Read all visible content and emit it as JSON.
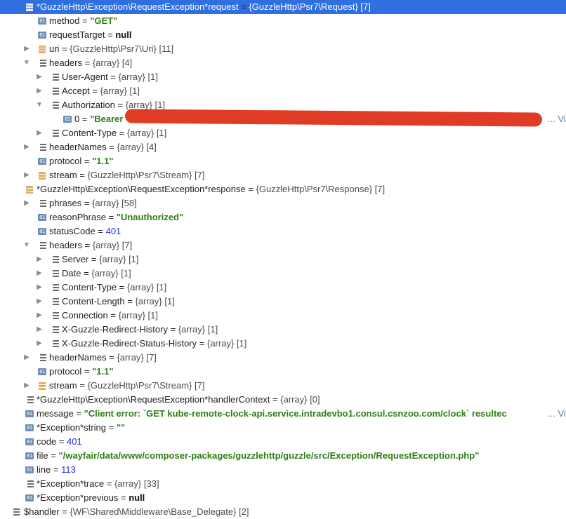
{
  "rows": [
    {
      "id": "request",
      "depth": 0,
      "arrow": "open",
      "icon": "obj",
      "name": "*GuzzleHttp\\Exception\\RequestException*request",
      "type": "{GuzzleHttp\\Psr7\\Request}",
      "count": "[7]",
      "selected": true
    },
    {
      "id": "method",
      "depth": 1,
      "icon": "prim",
      "name": "method",
      "value": "\"GET\"",
      "vkind": "str"
    },
    {
      "id": "requestTarget",
      "depth": 1,
      "icon": "prim",
      "name": "requestTarget",
      "value": "null",
      "vkind": "kw"
    },
    {
      "id": "uri",
      "depth": 1,
      "arrow": "closed",
      "icon": "obj",
      "name": "uri",
      "type": "{GuzzleHttp\\Psr7\\Uri}",
      "count": "[11]"
    },
    {
      "id": "headers1",
      "depth": 1,
      "arrow": "open",
      "icon": "list",
      "name": "headers",
      "type": "{array}",
      "count": "[4]"
    },
    {
      "id": "user-agent",
      "depth": 2,
      "arrow": "closed",
      "icon": "list",
      "name": "User-Agent",
      "type": "{array}",
      "count": "[1]"
    },
    {
      "id": "accept",
      "depth": 2,
      "arrow": "closed",
      "icon": "list",
      "name": "Accept",
      "type": "{array}",
      "count": "[1]"
    },
    {
      "id": "authorization",
      "depth": 2,
      "arrow": "open",
      "icon": "list",
      "name": "Authorization",
      "type": "{array}",
      "count": "[1]"
    },
    {
      "id": "auth-0",
      "depth": 3,
      "icon": "prim",
      "name": "0",
      "value": "\"Bearer",
      "vkind": "str",
      "tail": "... View"
    },
    {
      "id": "content-type1",
      "depth": 2,
      "arrow": "closed",
      "icon": "list",
      "name": "Content-Type",
      "type": "{array}",
      "count": "[1]"
    },
    {
      "id": "headerNames1",
      "depth": 1,
      "arrow": "closed",
      "icon": "list",
      "name": "headerNames",
      "type": "{array}",
      "count": "[4]"
    },
    {
      "id": "protocol1",
      "depth": 1,
      "icon": "prim",
      "name": "protocol",
      "value": "\"1.1\"",
      "vkind": "str"
    },
    {
      "id": "stream1",
      "depth": 1,
      "arrow": "closed",
      "icon": "obj",
      "name": "stream",
      "type": "{GuzzleHttp\\Psr7\\Stream}",
      "count": "[7]"
    },
    {
      "id": "response",
      "depth": 0,
      "arrow": "open",
      "icon": "obj",
      "name": "*GuzzleHttp\\Exception\\RequestException*response",
      "type": "{GuzzleHttp\\Psr7\\Response}",
      "count": "[7]"
    },
    {
      "id": "phrases",
      "depth": 1,
      "arrow": "closed",
      "icon": "list",
      "name": "phrases",
      "type": "{array}",
      "count": "[58]"
    },
    {
      "id": "reasonPhrase",
      "depth": 1,
      "icon": "prim",
      "name": "reasonPhrase",
      "value": "\"Unauthorized\"",
      "vkind": "str"
    },
    {
      "id": "statusCode",
      "depth": 1,
      "icon": "prim",
      "name": "statusCode",
      "value": "401",
      "vkind": "num"
    },
    {
      "id": "headers2",
      "depth": 1,
      "arrow": "open",
      "icon": "list",
      "name": "headers",
      "type": "{array}",
      "count": "[7]"
    },
    {
      "id": "server",
      "depth": 2,
      "arrow": "closed",
      "icon": "list",
      "name": "Server",
      "type": "{array}",
      "count": "[1]"
    },
    {
      "id": "date",
      "depth": 2,
      "arrow": "closed",
      "icon": "list",
      "name": "Date",
      "type": "{array}",
      "count": "[1]"
    },
    {
      "id": "content-type2",
      "depth": 2,
      "arrow": "closed",
      "icon": "list",
      "name": "Content-Type",
      "type": "{array}",
      "count": "[1]"
    },
    {
      "id": "content-length",
      "depth": 2,
      "arrow": "closed",
      "icon": "list",
      "name": "Content-Length",
      "type": "{array}",
      "count": "[1]"
    },
    {
      "id": "connection",
      "depth": 2,
      "arrow": "closed",
      "icon": "list",
      "name": "Connection",
      "type": "{array}",
      "count": "[1]"
    },
    {
      "id": "x-guzzle-redirect-history",
      "depth": 2,
      "arrow": "closed",
      "icon": "list",
      "name": "X-Guzzle-Redirect-History",
      "type": "{array}",
      "count": "[1]"
    },
    {
      "id": "x-guzzle-redirect-status-history",
      "depth": 2,
      "arrow": "closed",
      "icon": "list",
      "name": "X-Guzzle-Redirect-Status-History",
      "type": "{array}",
      "count": "[1]"
    },
    {
      "id": "headerNames2",
      "depth": 1,
      "arrow": "closed",
      "icon": "list",
      "name": "headerNames",
      "type": "{array}",
      "count": "[7]"
    },
    {
      "id": "protocol2",
      "depth": 1,
      "icon": "prim",
      "name": "protocol",
      "value": "\"1.1\"",
      "vkind": "str"
    },
    {
      "id": "stream2",
      "depth": 1,
      "arrow": "closed",
      "icon": "obj",
      "name": "stream",
      "type": "{GuzzleHttp\\Psr7\\Stream}",
      "count": "[7]"
    },
    {
      "id": "handlerContext",
      "depth": 0,
      "icon": "list",
      "name": "*GuzzleHttp\\Exception\\RequestException*handlerContext",
      "type": "{array}",
      "count": "[0]"
    },
    {
      "id": "message",
      "depth": 0,
      "icon": "prim",
      "name": "message",
      "value": "\"Client error: `GET kube-remote-clock-api.service.intradevbo1.consul.csnzoo.com/clock` resultec",
      "vkind": "str",
      "tail": "... View"
    },
    {
      "id": "exception-string",
      "depth": 0,
      "icon": "prim",
      "name": "*Exception*string",
      "value": "\"\"",
      "vkind": "str"
    },
    {
      "id": "code",
      "depth": 0,
      "icon": "prim",
      "name": "code",
      "value": "401",
      "vkind": "num"
    },
    {
      "id": "file",
      "depth": 0,
      "icon": "prim",
      "name": "file",
      "value": "\"/wayfair/data/www/composer-packages/guzzlehttp/guzzle/src/Exception/RequestException.php\"",
      "vkind": "str"
    },
    {
      "id": "line",
      "depth": 0,
      "icon": "prim",
      "name": "line",
      "value": "113",
      "vkind": "num"
    },
    {
      "id": "exception-trace",
      "depth": 0,
      "arrow": "closed",
      "icon": "list",
      "name": "*Exception*trace",
      "type": "{array}",
      "count": "[33]"
    },
    {
      "id": "exception-previous",
      "depth": 0,
      "icon": "prim",
      "name": "*Exception*previous",
      "value": "null",
      "vkind": "kw"
    },
    {
      "id": "handler",
      "depth": -1,
      "arrow": "closed",
      "icon": "list",
      "name": "$handler",
      "type": "{WF\\Shared\\Middleware\\Base_Delegate}",
      "count": "[2]"
    }
  ],
  "primitive_icon_label": "01",
  "icons": {
    "open": "triangle-down-icon",
    "closed": "triangle-right-icon",
    "obj": "object-icon",
    "list": "array-icon",
    "prim": "primitive-icon"
  },
  "colors": {
    "selection": "#2f6fe0",
    "string": "#2f7d14",
    "number": "#1f32e0",
    "redaction": "#e03b24"
  }
}
